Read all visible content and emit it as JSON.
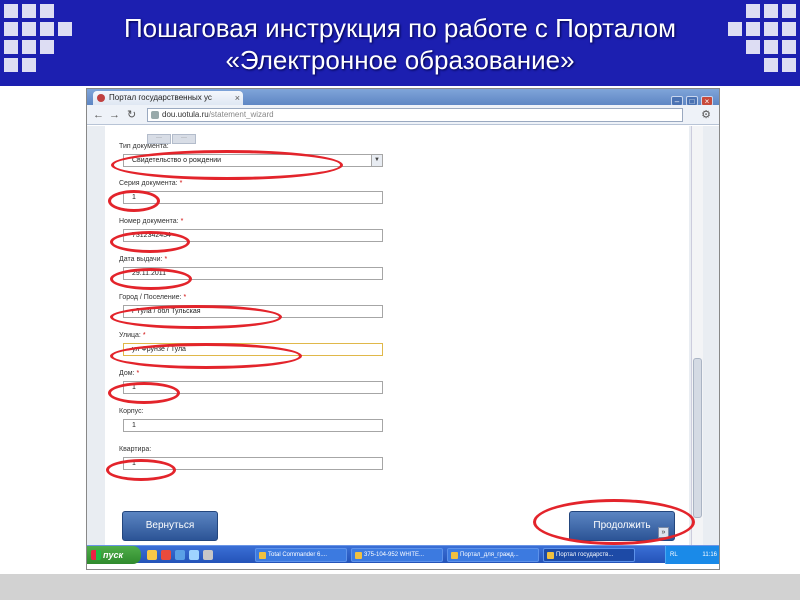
{
  "slide": {
    "title_line1": "Пошаговая инструкция по работе с Порталом",
    "title_line2": "«Электронное образование»"
  },
  "browser": {
    "tab_title": "Портал государственных ус",
    "url_host": "dou.uotula.ru",
    "url_path": "/statement_wizard"
  },
  "form": {
    "fields": [
      {
        "label": "Тип документа:",
        "required": false,
        "value": "Свидетельство о рождении",
        "type": "select"
      },
      {
        "label": "Серия документа:",
        "required": true,
        "value": "1"
      },
      {
        "label": "Номер документа:",
        "required": true,
        "value": "7312342434"
      },
      {
        "label": "Дата выдачи:",
        "required": true,
        "value": "29.11.2011"
      },
      {
        "label": "Город / Поселение:",
        "required": true,
        "value": "г Тула / обл Тульская"
      },
      {
        "label": "Улица:",
        "required": true,
        "value": "ул Фрунзе / Тула"
      },
      {
        "label": "Дом:",
        "required": true,
        "value": "1"
      },
      {
        "label": "Корпус:",
        "required": false,
        "value": "1"
      },
      {
        "label": "Квартира:",
        "required": false,
        "value": "1"
      }
    ],
    "required_mark": "*",
    "back_button": "Вернуться",
    "next_button": "Продолжить"
  },
  "taskbar": {
    "start_label": "пуск",
    "tasks": [
      "Total Commander 6....",
      "375-104-952 WHITE...",
      "Портал_для_гражд...",
      "Портал государств..."
    ],
    "language": "RL",
    "clock": "11:16"
  },
  "colors": {
    "header_bg": "#1c1fb0",
    "annotation": "#e3242b",
    "button": "#3a66a8"
  }
}
